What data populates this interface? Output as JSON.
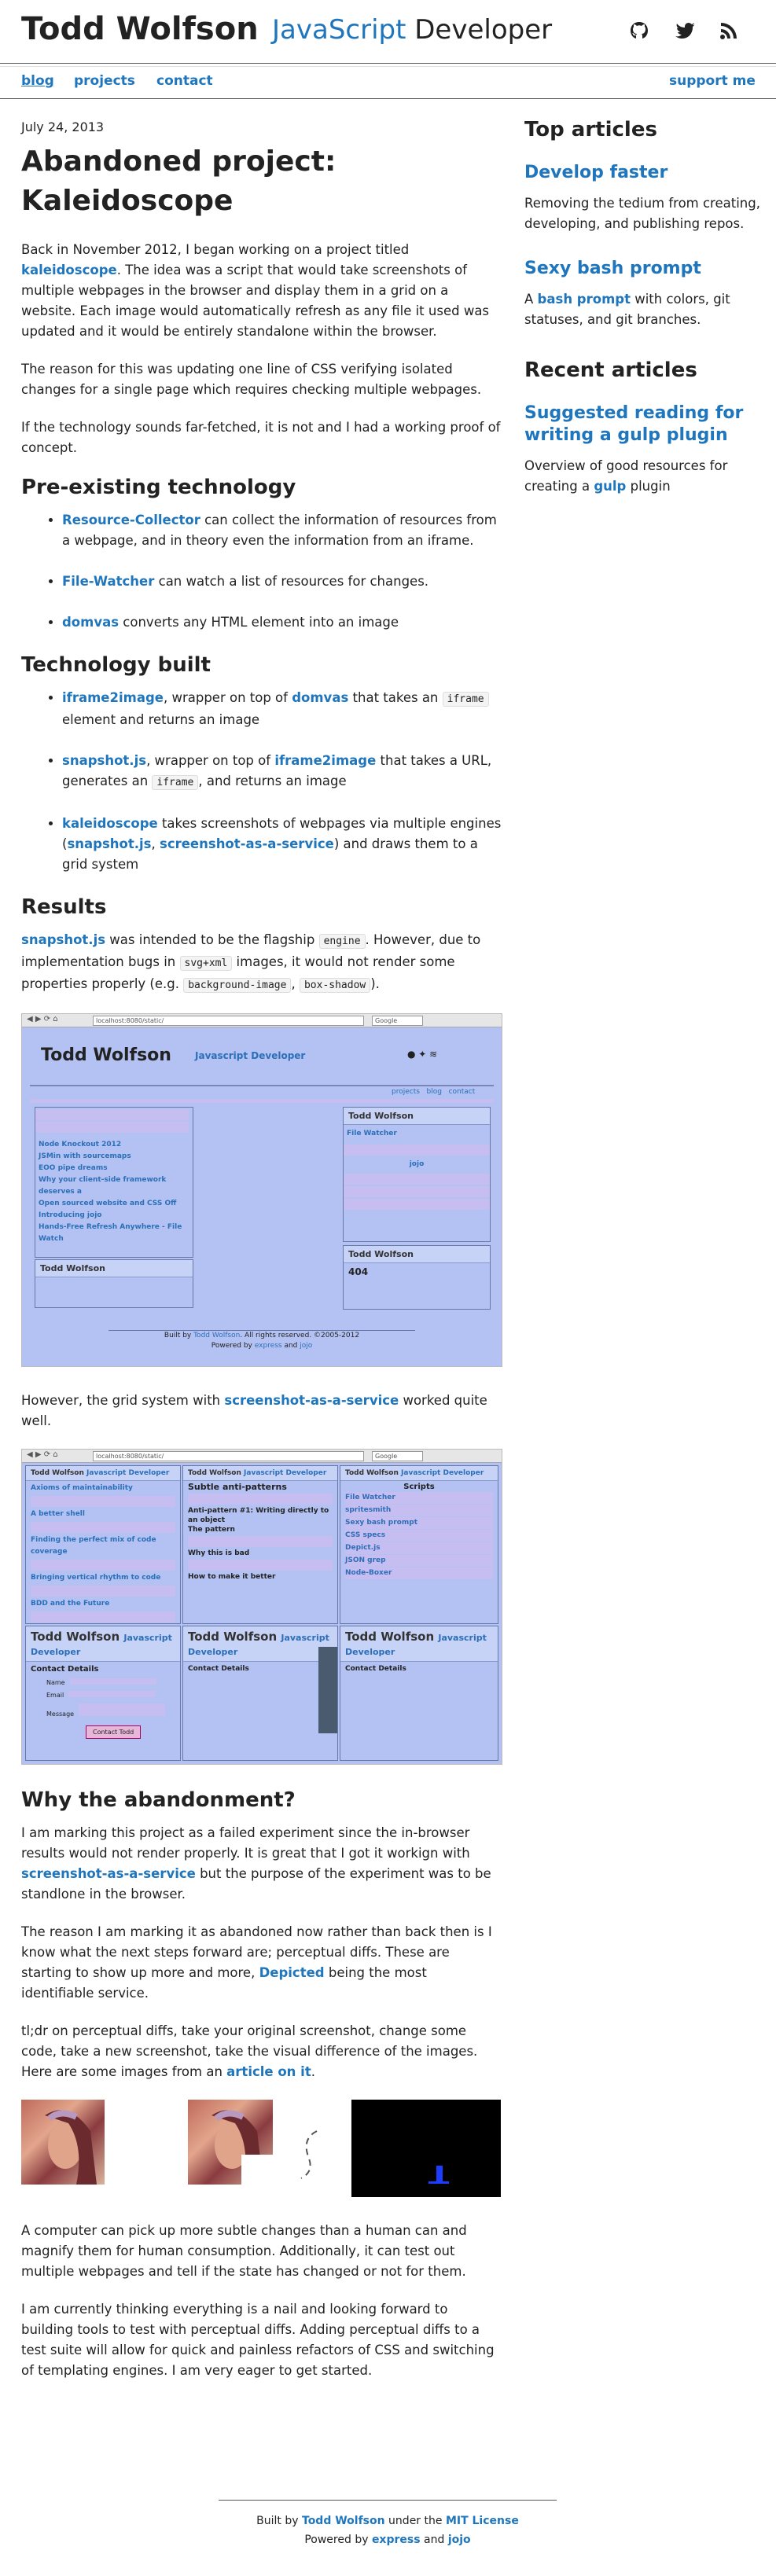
{
  "header": {
    "site_name": "Todd Wolfson",
    "role_accent": "JavaScript",
    "role_rest": " Developer",
    "social_icons": [
      "github-icon",
      "twitter-icon",
      "rss-icon"
    ]
  },
  "nav": {
    "blog": "blog",
    "projects": "projects",
    "contact": "contact",
    "support": "support me"
  },
  "post": {
    "date": "July 24, 2013",
    "title": "Abandoned project: Kaleidoscope",
    "intro_p1_a": "Back in November 2012, I began working on a project titled ",
    "intro_p1_link": "kaleidoscope",
    "intro_p1_b": ". The idea was a script that would take screenshots of multiple webpages in the browser and display them in a grid on a website. Each image would automatically refresh as any file it used was updated and it would be entirely standalone within the browser.",
    "intro_p2": "The reason for this was updating one line of CSS verifying isolated changes for a single page which requires checking multiple webpages.",
    "intro_p3": "If the technology sounds far-fetched, it is not and I had a working proof of concept.",
    "pre_heading": "Pre-existing technology",
    "pre_items": [
      {
        "link": "Resource-Collector",
        "text": " can collect the information of resources from a webpage, and in theory even the information from an iframe."
      },
      {
        "link": "File-Watcher",
        "text": " can watch a list of resources for changes."
      },
      {
        "link": "domvas",
        "text": " converts any HTML element into an image"
      }
    ],
    "built_heading": "Technology built",
    "built_1_link": "iframe2image",
    "built_1_a": ", wrapper on top of ",
    "built_1_link2": "domvas",
    "built_1_b": " that takes an ",
    "built_1_code": "iframe",
    "built_1_c": " element and returns an image",
    "built_2_link": "snapshot.js",
    "built_2_a": ", wrapper on top of ",
    "built_2_link2": "iframe2image",
    "built_2_b": " that takes a URL, generates an ",
    "built_2_code": "iframe",
    "built_2_c": ", and returns an image",
    "built_3_link": "kaleidoscope",
    "built_3_a": " takes screenshots of webpages via multiple engines (",
    "built_3_link2": "snapshot.js",
    "built_3_sep": ", ",
    "built_3_link3": "screenshot-as-a-service",
    "built_3_b": ") and draws them to a grid system",
    "results_heading": "Results",
    "results_link": "snapshot.js",
    "results_a": " was intended to be the flagship ",
    "results_code1": "engine",
    "results_b": ". However, due to implementation bugs in ",
    "results_code2": "svg+xml",
    "results_c": " images, it would not render some properties properly (e.g. ",
    "results_code3": "background-image",
    "results_sep": ", ",
    "results_code4": "box-shadow",
    "results_d": ").",
    "grid_a": "However, the grid system with ",
    "grid_link": "screenshot-as-a-service",
    "grid_b": " worked quite well.",
    "why_heading": "Why the abandonment?",
    "why_p1_a": "I am marking this project as a failed experiment since the in-browser results would not render properly. It is great that I got it workign with ",
    "why_p1_link": "screenshot-as-a-service",
    "why_p1_b": " but the purpose of the experiment was to be standlone in the browser.",
    "why_p2_a": "The reason I am marking it as abandoned now rather than back then is I know what the next steps forward are; perceptual diffs. These are starting to show up more and more, ",
    "why_p2_link": "Depicted",
    "why_p2_b": " being the most identifiable service.",
    "why_p3_a": "tl;dr on perceptual diffs, take your original screenshot, change some code, take a new screenshot, take the visual difference of the images. Here are some images from an ",
    "why_p3_link": "article on it",
    "why_p3_b": ".",
    "end_p1": "A computer can pick up more subtle changes than a human can and magnify them for human consumption. Additionally, it can test out multiple webpages and tell if the state has changed or not for them.",
    "end_p2": "I am currently thinking everything is a nail and looking forward to building tools to test with perceptual diffs. Adding perceptual diffs to a test suite will allow for quick and painless refactors of CSS and switching of templating engines. I am very eager to get started."
  },
  "shot1": {
    "url": "localhost:8080/static/",
    "search": "Google",
    "title": "Todd Wolfson",
    "role": "Javascript Developer",
    "nav": [
      "projects",
      "blog",
      "contact"
    ],
    "items": [
      "Node Knockout 2012",
      "JSMin with sourcemaps",
      "EOO pipe dreams",
      "Why your client-side framework deserves a",
      "Open sourced website and CSS Off",
      "Introducing jojo",
      "Hands-Free Refresh Anywhere - File Watch"
    ],
    "inner_items": [
      "File Watcher",
      "jojo"
    ],
    "not_found": "404",
    "footer_a": "Built by ",
    "footer_link": "Todd Wolfson",
    "footer_b": ". All rights reserved. ©2005-2012",
    "footer2_a": "Powered by ",
    "footer2_link1": "express",
    "footer2_and": " and ",
    "footer2_link2": "jojo"
  },
  "shot2": {
    "url": "localhost:8080/static/",
    "search": "Google",
    "pane_title": "Todd Wolfson",
    "pane_role": "Javascript Developer",
    "left_items": [
      "Axioms of maintainability",
      "A better shell",
      "Finding the perfect mix of code coverage",
      "Bringing vertical rhythm to code",
      "BDD and the Future"
    ],
    "mid_title": "Subtle anti-patterns",
    "mid_sub": "Anti-pattern #1: Writing directly to an object",
    "mid_fix": "The pattern",
    "mid_bad": "Why this is bad",
    "mid_howto": "How to make it better",
    "right_title": "Scripts",
    "right_items": [
      "File Watcher",
      "spritesmith",
      "Sexy bash prompt",
      "CSS specs",
      "Depict.js",
      "JSON grep",
      "Node-Boxer"
    ],
    "contact_title": "Contact Details",
    "contact_labels": [
      "Name",
      "Email",
      "Message"
    ],
    "contact_button": "Contact Todd"
  },
  "sidebar": {
    "top_heading": "Top articles",
    "top_1_title": "Develop faster",
    "top_1_desc": "Removing the tedium from creating, developing, and publishing repos.",
    "top_2_title": "Sexy bash prompt",
    "top_2_desc_a": "A ",
    "top_2_desc_link": "bash prompt",
    "top_2_desc_b": " with colors, git statuses, and git branches.",
    "recent_heading": "Recent articles",
    "recent_1_title": "Suggested reading for writing a gulp plugin",
    "recent_1_desc_a": "Overview of good resources for creating a ",
    "recent_1_desc_link": "gulp",
    "recent_1_desc_b": " plugin"
  },
  "footer": {
    "line1_a": "Built by ",
    "line1_link1": "Todd Wolfson",
    "line1_b": " under the ",
    "line1_link2": "MIT License",
    "line2_a": "Powered by ",
    "line2_link1": "express",
    "line2_and": " and ",
    "line2_link2": "jojo"
  },
  "colors": {
    "link": "#1f76bc",
    "shot_bg": "#b3c2f2"
  }
}
